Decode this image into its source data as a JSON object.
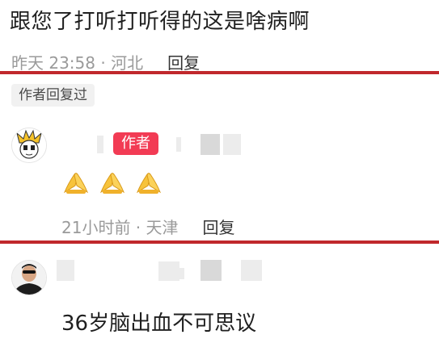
{
  "comment1": {
    "text": "跟您了打听打听得的这是啥病啊",
    "meta": "昨天 23:58 · 河北",
    "reply_label": "回复"
  },
  "author_replied_tag": "作者回复过",
  "comment2": {
    "author_badge": "作者",
    "emoji_icons": [
      "folded-hands-icon",
      "folded-hands-icon",
      "folded-hands-icon"
    ],
    "meta": "21小时前 · 天津",
    "reply_label": "回复"
  },
  "comment3": {
    "text": "36岁脑出血不可思议"
  },
  "colors": {
    "divider_red": "#c0282c",
    "author_badge_bg": "#f23b54",
    "meta_gray": "#9a9a9a",
    "text_dark": "#1f1f1f"
  }
}
